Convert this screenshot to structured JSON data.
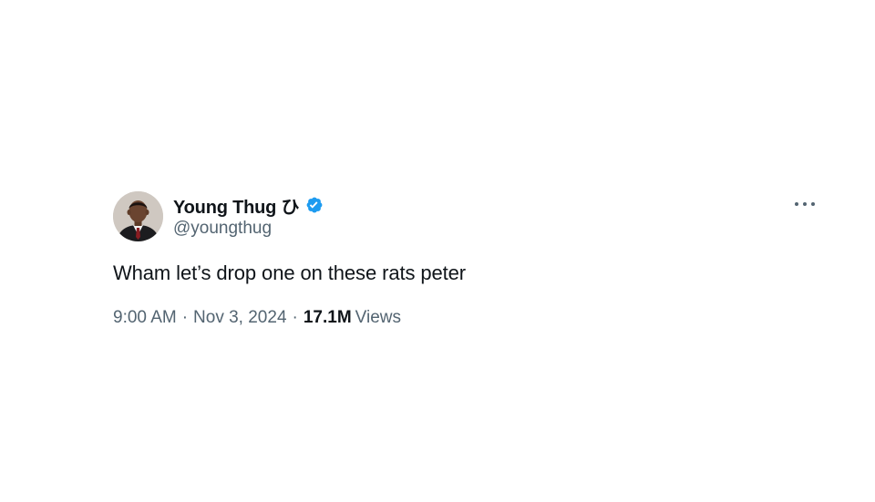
{
  "tweet": {
    "display_name": "Young Thug ひ",
    "handle": "@youngthug",
    "verified": true,
    "text": "Wham let’s drop one on these rats peter",
    "time": "9:00 AM",
    "separator": "·",
    "date": "Nov 3, 2024",
    "views_count": "17.1M",
    "views_label": "Views",
    "more_icon": "more-horizontal-icon"
  },
  "colors": {
    "text_primary": "#0f1419",
    "text_secondary": "#536471",
    "verified_blue": "#1d9bf0"
  }
}
